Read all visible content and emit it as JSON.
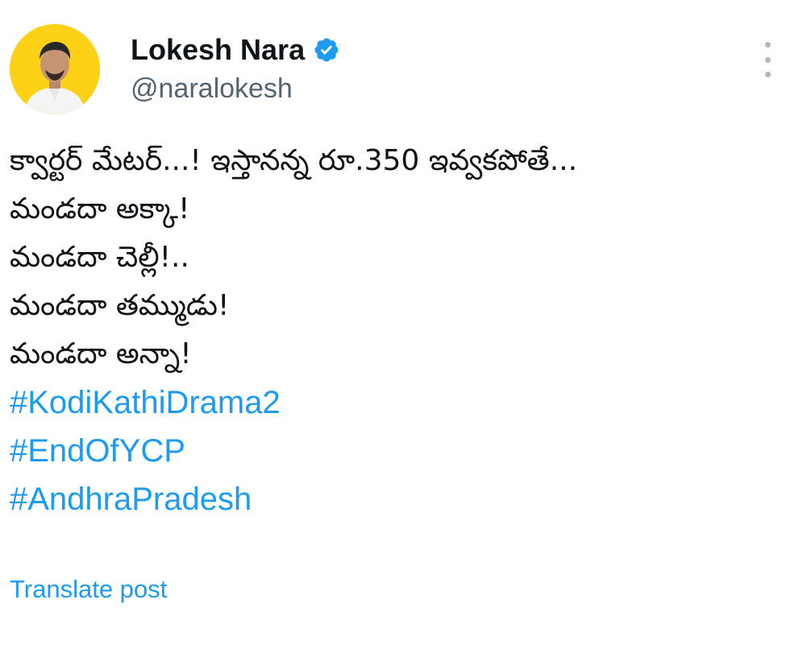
{
  "author": {
    "name": "Lokesh Nara",
    "handle": "@naralokesh",
    "avatar_icon": "profile-photo",
    "verified_icon": "verified-badge-icon",
    "avatar_bg": "#fcd116"
  },
  "post": {
    "lines": [
      "క్వార్టర్ మేటర్...! ఇస్తానన్న రూ.350 ఇవ్వకపోతే...",
      "మండదా అక్కా!",
      "మండదా చెల్లీ!..",
      "మండదా తమ్ముడు!",
      "మండదా అన్నా!"
    ],
    "hashtags": [
      "#KodiKathiDrama2",
      "#EndOfYCP",
      "#AndhraPradesh"
    ],
    "translate_label": "Translate post"
  },
  "menu_icon": "more-vertical-icon",
  "colors": {
    "link": "#1d9bf0",
    "text": "#0f1419",
    "secondary": "#536471"
  }
}
